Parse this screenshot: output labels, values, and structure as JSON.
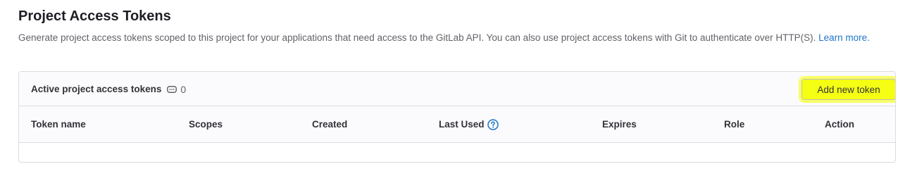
{
  "section": {
    "title": "Project Access Tokens",
    "description": "Generate project access tokens scoped to this project for your applications that need access to the GitLab API. You can also use project access tokens with Git to authenticate over HTTP(S).",
    "learn_more": "Learn more."
  },
  "card": {
    "title": "Active project access tokens",
    "count": "0",
    "count_icon": "token-icon",
    "add_button": "Add new token"
  },
  "table": {
    "columns": [
      {
        "label": "Token name"
      },
      {
        "label": "Scopes"
      },
      {
        "label": "Created"
      },
      {
        "label": "Last Used",
        "help_icon": "question-circle-icon"
      },
      {
        "label": "Expires"
      },
      {
        "label": "Role"
      },
      {
        "label": "Action"
      }
    ]
  },
  "colors": {
    "link": "#1f75cb",
    "highlight": "#f5ff13"
  }
}
